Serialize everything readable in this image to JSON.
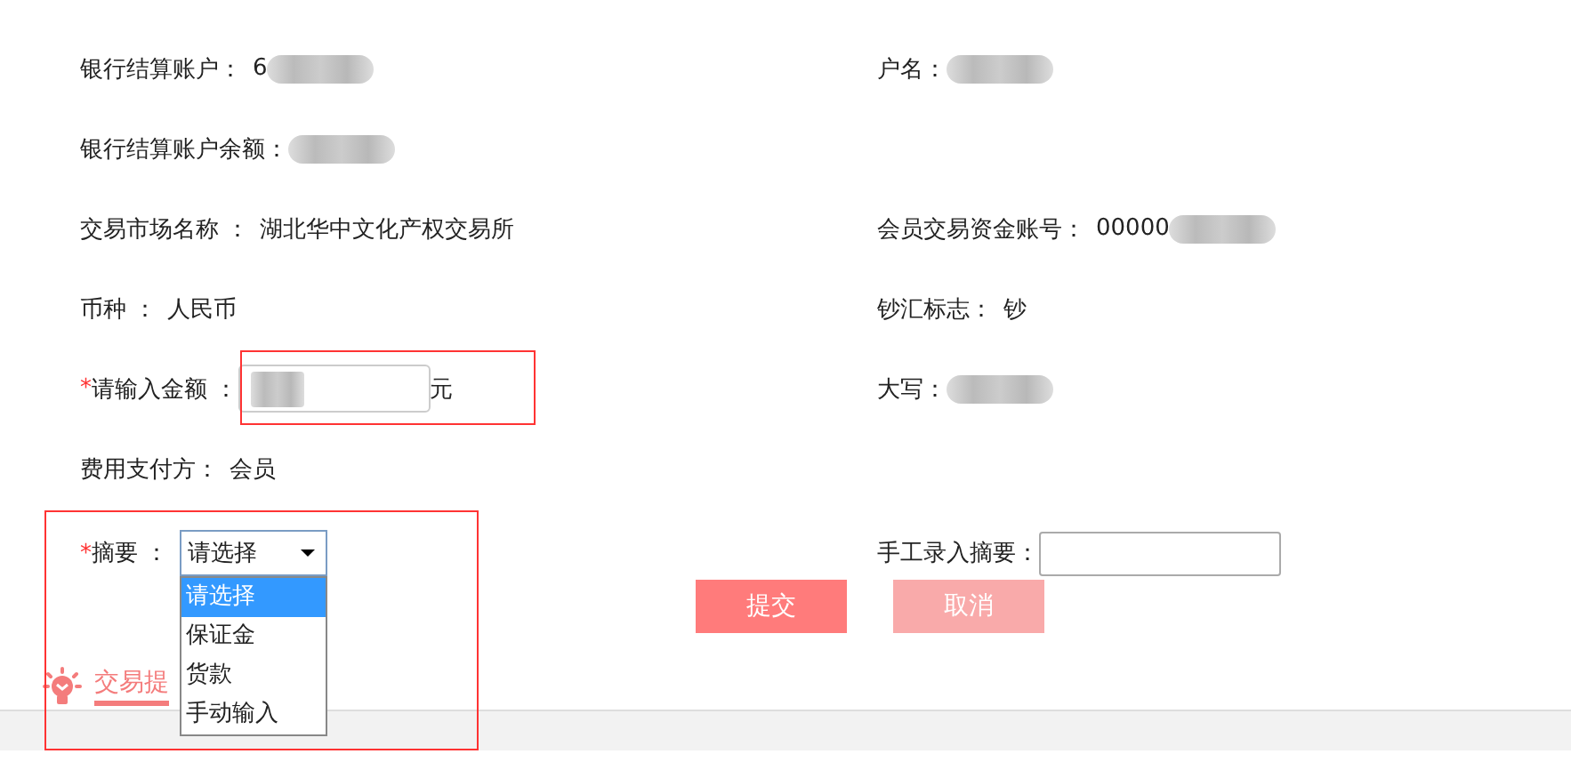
{
  "rows": [
    {
      "left": {
        "kind": "text",
        "label": "银行结算账户：",
        "value": "6",
        "redacted": true
      },
      "right": {
        "kind": "text",
        "label": "户名：",
        "redacted": true
      }
    },
    {
      "left": {
        "kind": "text",
        "label": "银行结算账户余额：",
        "redacted": true
      },
      "right": null
    },
    {
      "left": {
        "kind": "text",
        "label": "交易市场名称 ：",
        "value": "湖北华中文化产权交易所"
      },
      "right": {
        "kind": "text",
        "label": "会员交易资金账号：",
        "value": "00000",
        "redacted": true
      }
    },
    {
      "left": {
        "kind": "text",
        "label": "币种 ：",
        "value": "人民币"
      },
      "right": {
        "kind": "text",
        "label": "钞汇标志：",
        "value": "钞"
      }
    },
    {
      "left": {
        "kind": "amount",
        "required": "*",
        "label": "请输入金额 ：",
        "redacted": true,
        "unit": "元"
      },
      "right": {
        "kind": "text",
        "label": "大写：",
        "redacted": true
      }
    },
    {
      "left": {
        "kind": "text",
        "label": "费用支付方：",
        "value": "会员"
      },
      "right": null
    },
    {
      "left": {
        "kind": "select",
        "required": "*",
        "label": "摘要 ：",
        "value": "请选择",
        "options": [
          {
            "label": "请选择",
            "selected": true
          },
          {
            "label": "保证金",
            "selected": false
          },
          {
            "label": "货款",
            "selected": false
          },
          {
            "label": "手动输入",
            "selected": false
          }
        ]
      },
      "right": {
        "kind": "input",
        "label": "手工录入摘要："
      }
    }
  ],
  "buttons": [
    {
      "label": "提交",
      "kind": "primary"
    },
    {
      "label": "取消",
      "kind": "secondary"
    }
  ],
  "tip": {
    "label": "交易提"
  }
}
